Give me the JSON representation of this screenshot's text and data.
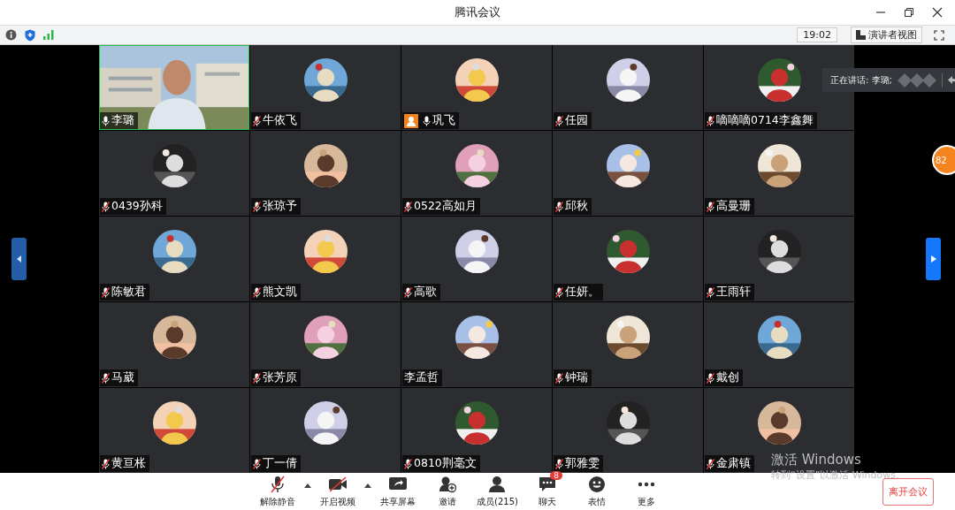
{
  "window": {
    "title": "腾讯会议"
  },
  "status_bar": {
    "time": "19:02",
    "view_button": "演讲者视图"
  },
  "speaking": {
    "label": "正在讲话: 李璐;"
  },
  "badge_count": "82",
  "tiles": [
    {
      "name": "李璐",
      "kind": "video",
      "mic_icon": true,
      "muted": false,
      "host": false,
      "speaking": true
    },
    {
      "name": "牛依飞",
      "kind": "avatar",
      "mic_icon": true,
      "muted": true,
      "host": false,
      "speaking": false
    },
    {
      "name": "巩飞",
      "kind": "avatar",
      "mic_icon": true,
      "muted": false,
      "host": true,
      "speaking": false
    },
    {
      "name": "任园",
      "kind": "avatar",
      "mic_icon": true,
      "muted": true,
      "host": false,
      "speaking": false
    },
    {
      "name": "嘀嘀嘀0714李鑫舞",
      "kind": "avatar",
      "mic_icon": true,
      "muted": true,
      "host": false,
      "speaking": false
    },
    {
      "name": "0439孙科",
      "kind": "avatar",
      "mic_icon": true,
      "muted": true,
      "host": false,
      "speaking": false
    },
    {
      "name": "张琼予",
      "kind": "avatar",
      "mic_icon": true,
      "muted": true,
      "host": false,
      "speaking": false
    },
    {
      "name": "0522高如月",
      "kind": "avatar",
      "mic_icon": true,
      "muted": true,
      "host": false,
      "speaking": false
    },
    {
      "name": "邱秋",
      "kind": "avatar",
      "mic_icon": true,
      "muted": true,
      "host": false,
      "speaking": false
    },
    {
      "name": "高曼珊",
      "kind": "avatar",
      "mic_icon": true,
      "muted": true,
      "host": false,
      "speaking": false
    },
    {
      "name": "陈敏君",
      "kind": "avatar",
      "mic_icon": true,
      "muted": true,
      "host": false,
      "speaking": false
    },
    {
      "name": "熊文凯",
      "kind": "avatar",
      "mic_icon": true,
      "muted": true,
      "host": false,
      "speaking": false
    },
    {
      "name": "高歌",
      "kind": "avatar",
      "mic_icon": true,
      "muted": true,
      "host": false,
      "speaking": false
    },
    {
      "name": "任妍。",
      "kind": "avatar",
      "mic_icon": true,
      "muted": true,
      "host": false,
      "speaking": false
    },
    {
      "name": "王雨轩",
      "kind": "avatar",
      "mic_icon": true,
      "muted": true,
      "host": false,
      "speaking": false
    },
    {
      "name": "马葳",
      "kind": "avatar",
      "mic_icon": true,
      "muted": true,
      "host": false,
      "speaking": false
    },
    {
      "name": "张芳原",
      "kind": "avatar",
      "mic_icon": true,
      "muted": true,
      "host": false,
      "speaking": false
    },
    {
      "name": "李孟哲",
      "kind": "avatar",
      "mic_icon": false,
      "host": false,
      "speaking": false
    },
    {
      "name": "钟瑞",
      "kind": "avatar",
      "mic_icon": true,
      "muted": true,
      "host": false,
      "speaking": false
    },
    {
      "name": "戴创",
      "kind": "avatar",
      "mic_icon": true,
      "muted": true,
      "host": false,
      "speaking": false
    },
    {
      "name": "黄亘枨",
      "kind": "avatar",
      "mic_icon": true,
      "muted": true,
      "host": false,
      "speaking": false
    },
    {
      "name": "丁一倩",
      "kind": "avatar",
      "mic_icon": true,
      "muted": true,
      "host": false,
      "speaking": false
    },
    {
      "name": "0810荆毫文",
      "kind": "avatar",
      "mic_icon": true,
      "muted": true,
      "host": false,
      "speaking": false
    },
    {
      "name": "郭雅雯",
      "kind": "avatar",
      "mic_icon": true,
      "muted": true,
      "host": false,
      "speaking": false
    },
    {
      "name": "金肃镇",
      "kind": "avatar",
      "mic_icon": true,
      "muted": true,
      "host": false,
      "speaking": false
    }
  ],
  "toolbar": [
    {
      "label": "解除静音",
      "kind": "mic",
      "caret": true
    },
    {
      "label": "开启视频",
      "kind": "camera",
      "caret": true
    },
    {
      "label": "共享屏幕",
      "kind": "share",
      "caret": false
    },
    {
      "label": "邀请",
      "kind": "invite",
      "caret": false
    },
    {
      "label": "成员(215)",
      "kind": "members",
      "caret": false
    },
    {
      "label": "聊天",
      "kind": "chat",
      "caret": false,
      "badge": "8"
    },
    {
      "label": "表情",
      "kind": "emoji",
      "caret": false
    },
    {
      "label": "更多",
      "kind": "more",
      "caret": false
    }
  ],
  "leave_button": "离开会议",
  "os_notice": {
    "title": "激活 Windows",
    "hint": "转到“设置”以激活 Windows。"
  }
}
